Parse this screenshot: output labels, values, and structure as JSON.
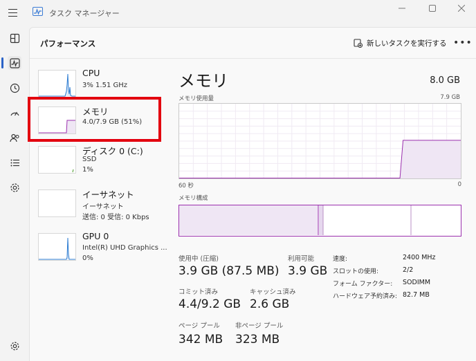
{
  "window": {
    "title": "タスク マネージャー"
  },
  "toolbar": {
    "page_title": "パフォーマンス",
    "run_new_task_label": "新しいタスクを実行する",
    "more_label": "•••"
  },
  "resources": [
    {
      "name": "CPU",
      "sub1": "3%  1.51 GHz",
      "sub2": ""
    },
    {
      "name": "メモリ",
      "sub1": "4.0/7.9 GB (51%)",
      "sub2": ""
    },
    {
      "name": "ディスク 0 (C:)",
      "sub1": "SSD",
      "sub2": "1%"
    },
    {
      "name": "イーサネット",
      "sub1": "イーサネット",
      "sub2": "送信: 0  受信: 0 Kbps"
    },
    {
      "name": "GPU 0",
      "sub1": "Intel(R) UHD Graphics ...",
      "sub2": "0%"
    }
  ],
  "detail": {
    "title": "メモリ",
    "total": "8.0 GB",
    "usage_label": "メモリ使用量",
    "usage_max": "7.9 GB",
    "time_left": "60 秒",
    "time_right": "0",
    "composition_label": "メモリ構成",
    "usage_fraction": 0.51
  },
  "stats": {
    "in_use_label": "使用中 (圧縮)",
    "in_use_value": "3.9 GB (87.5 MB)",
    "available_label": "利用可能",
    "available_value": "3.9 GB",
    "committed_label": "コミット済み",
    "committed_value": "4.4/9.2 GB",
    "cached_label": "キャッシュ済み",
    "cached_value": "2.6 GB",
    "paged_label": "ページ プール",
    "paged_value": "342 MB",
    "nonpaged_label": "非ページ プール",
    "nonpaged_value": "323 MB"
  },
  "specs": [
    {
      "label": "速度:",
      "value": "2400 MHz"
    },
    {
      "label": "スロットの使用:",
      "value": "2/2"
    },
    {
      "label": "フォーム ファクター:",
      "value": "SODIMM"
    },
    {
      "label": "ハードウェア予約済み:",
      "value": "82.7 MB"
    }
  ],
  "colors": {
    "accent": "#2b63c7",
    "memory": "#9b2fae",
    "memory_fill": "#efe6f4",
    "highlight": "#e3000f"
  }
}
